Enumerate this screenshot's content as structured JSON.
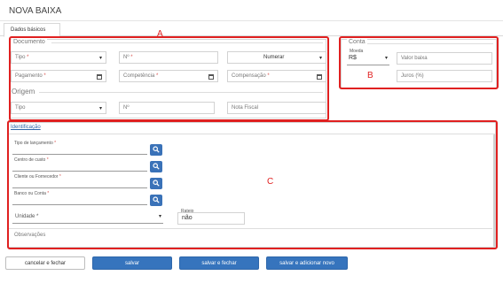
{
  "page": {
    "title": "NOVA BAIXA"
  },
  "tabs": [
    {
      "label": "Dados básicos"
    }
  ],
  "annotations": {
    "a": "A",
    "b": "B",
    "c": "C"
  },
  "documento": {
    "legend": "Documento",
    "tipo": "Tipo",
    "numero": "Nº",
    "numerar": "Numerar",
    "pagamento": "Pagamento",
    "competencia": "Competência",
    "compensacao": "Compensação",
    "required_mark": "*"
  },
  "origem": {
    "legend": "Origem",
    "tipo": "Tipo",
    "numero": "Nº",
    "nota_fiscal": "Nota Fiscal"
  },
  "conta": {
    "legend": "Conta",
    "moeda_label": "Moeda",
    "moeda_value": "R$",
    "valor_baixa": "Valor baixa",
    "juros": "Juros (%)"
  },
  "identificacao": {
    "link": "Identificação",
    "tipo_lancamento": "Tipo de lançamento",
    "centro_custo": "Centro de custo",
    "cliente_fornecedor": "Cliente ou Fornecedor",
    "banco_conta": "Banco ou Conta",
    "unidade": "Unidade",
    "rateio_label": "Rateio",
    "rateio_value": "não",
    "observacoes": "Observações"
  },
  "footer": {
    "cancelar": "cancelar e fechar",
    "salvar": "salvar",
    "salvar_fechar": "salvar e fechar",
    "salvar_novo": "salvar e adicionar novo"
  },
  "colors": {
    "primary": "#3674bd",
    "annotation": "#e02020",
    "required": "#d9534f"
  },
  "icons": [
    "chevron-down-icon",
    "calendar-icon",
    "search-icon"
  ]
}
